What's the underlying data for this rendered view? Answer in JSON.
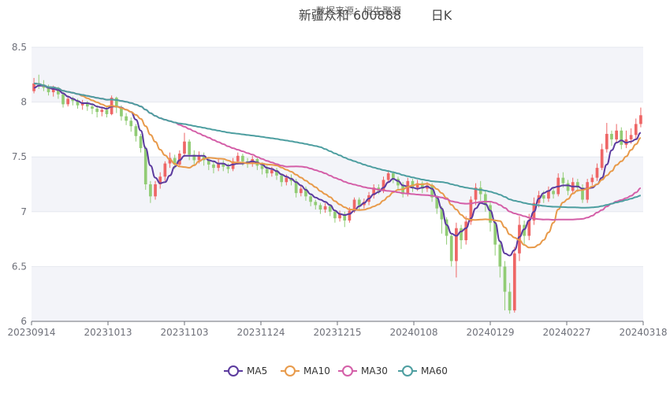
{
  "chart_data": {
    "type": "candlestick",
    "title": "新疆众和 600888",
    "subtitle": "日K",
    "source": "数据来源：恒生聚源",
    "ylim": [
      6,
      8.5
    ],
    "yticks": [
      "6",
      "6.5",
      "7",
      "7.5",
      "8",
      "8.5"
    ],
    "xticks": [
      "20230914",
      "20231013",
      "20231103",
      "20231124",
      "20231215",
      "20240108",
      "20240129",
      "20240227",
      "20240318"
    ],
    "up_color": "#ee6666",
    "down_color": "#91cc75",
    "band_colors": [
      "#f3f4f9",
      "#ffffff"
    ],
    "grid": true,
    "legend_position": "bottom-center",
    "series": [
      {
        "name": "MA5",
        "color": "#5b3a9e"
      },
      {
        "name": "MA10",
        "color": "#e89a4a"
      },
      {
        "name": "MA30",
        "color": "#d45fa8"
      },
      {
        "name": "MA60",
        "color": "#4d9ea0"
      }
    ],
    "candles": [
      [
        8.1,
        8.17,
        8.22,
        8.08
      ],
      [
        8.17,
        8.16,
        8.25,
        8.12
      ],
      [
        8.16,
        8.13,
        8.2,
        8.1
      ],
      [
        8.13,
        8.09,
        8.16,
        8.06
      ],
      [
        8.09,
        8.12,
        8.15,
        8.05
      ],
      [
        8.12,
        8.07,
        8.14,
        8.03
      ],
      [
        8.07,
        7.98,
        8.09,
        7.95
      ],
      [
        7.98,
        8.03,
        8.06,
        7.96
      ],
      [
        8.03,
        8.01,
        8.05,
        7.97
      ],
      [
        8.01,
        7.97,
        8.03,
        7.94
      ],
      [
        7.97,
        7.99,
        8.02,
        7.93
      ],
      [
        7.99,
        7.96,
        8.01,
        7.92
      ],
      [
        7.96,
        7.94,
        7.99,
        7.89
      ],
      [
        7.94,
        7.91,
        7.97,
        7.86
      ],
      [
        7.91,
        7.93,
        7.96,
        7.87
      ],
      [
        7.93,
        7.89,
        7.96,
        7.86
      ],
      [
        7.89,
        8.04,
        8.06,
        7.88
      ],
      [
        8.04,
        7.95,
        8.05,
        7.9
      ],
      [
        7.95,
        7.87,
        7.97,
        7.83
      ],
      [
        7.87,
        7.83,
        7.9,
        7.79
      ],
      [
        7.83,
        7.78,
        7.86,
        7.73
      ],
      [
        7.78,
        7.69,
        7.8,
        7.64
      ],
      [
        7.69,
        7.58,
        7.71,
        7.54
      ],
      [
        7.58,
        7.25,
        7.6,
        7.2
      ],
      [
        7.25,
        7.14,
        7.28,
        7.08
      ],
      [
        7.14,
        7.25,
        7.28,
        7.11
      ],
      [
        7.25,
        7.32,
        7.36,
        7.21
      ],
      [
        7.32,
        7.44,
        7.46,
        7.28
      ],
      [
        7.44,
        7.49,
        7.54,
        7.4
      ],
      [
        7.49,
        7.43,
        7.52,
        7.39
      ],
      [
        7.43,
        7.53,
        7.56,
        7.41
      ],
      [
        7.53,
        7.64,
        7.72,
        7.5
      ],
      [
        7.64,
        7.52,
        7.66,
        7.47
      ],
      [
        7.52,
        7.47,
        7.56,
        7.43
      ],
      [
        7.47,
        7.51,
        7.55,
        7.44
      ],
      [
        7.51,
        7.47,
        7.54,
        7.42
      ],
      [
        7.47,
        7.43,
        7.5,
        7.38
      ],
      [
        7.43,
        7.4,
        7.46,
        7.35
      ],
      [
        7.4,
        7.44,
        7.48,
        7.37
      ],
      [
        7.44,
        7.41,
        7.47,
        7.37
      ],
      [
        7.41,
        7.39,
        7.44,
        7.35
      ],
      [
        7.39,
        7.46,
        7.49,
        7.37
      ],
      [
        7.46,
        7.51,
        7.54,
        7.43
      ],
      [
        7.51,
        7.46,
        7.53,
        7.42
      ],
      [
        7.46,
        7.44,
        7.49,
        7.4
      ],
      [
        7.44,
        7.48,
        7.51,
        7.41
      ],
      [
        7.48,
        7.42,
        7.5,
        7.38
      ],
      [
        7.42,
        7.39,
        7.45,
        7.34
      ],
      [
        7.39,
        7.35,
        7.42,
        7.31
      ],
      [
        7.35,
        7.38,
        7.41,
        7.32
      ],
      [
        7.38,
        7.33,
        7.4,
        7.29
      ],
      [
        7.33,
        7.27,
        7.35,
        7.23
      ],
      [
        7.27,
        7.31,
        7.34,
        7.24
      ],
      [
        7.31,
        7.28,
        7.34,
        7.24
      ],
      [
        7.28,
        7.17,
        7.3,
        7.13
      ],
      [
        7.17,
        7.21,
        7.24,
        7.14
      ],
      [
        7.21,
        7.14,
        7.23,
        7.1
      ],
      [
        7.14,
        7.09,
        7.16,
        7.05
      ],
      [
        7.09,
        7.06,
        7.11,
        7.02
      ],
      [
        7.06,
        7.02,
        7.08,
        6.98
      ],
      [
        7.02,
        7.05,
        7.08,
        6.99
      ],
      [
        7.05,
        7.0,
        7.07,
        6.96
      ],
      [
        7.0,
        6.94,
        7.02,
        6.9
      ],
      [
        6.94,
        6.98,
        7.01,
        6.91
      ],
      [
        6.98,
        6.92,
        7.0,
        6.86
      ],
      [
        6.92,
        7.01,
        7.04,
        6.9
      ],
      [
        7.01,
        7.11,
        7.13,
        6.99
      ],
      [
        7.11,
        7.06,
        7.13,
        7.02
      ],
      [
        7.06,
        7.09,
        7.12,
        7.03
      ],
      [
        7.09,
        7.15,
        7.18,
        7.06
      ],
      [
        7.15,
        7.22,
        7.25,
        7.12
      ],
      [
        7.22,
        7.19,
        7.25,
        7.16
      ],
      [
        7.19,
        7.29,
        7.32,
        7.17
      ],
      [
        7.29,
        7.35,
        7.38,
        7.26
      ],
      [
        7.35,
        7.3,
        7.37,
        7.26
      ],
      [
        7.3,
        7.24,
        7.32,
        7.2
      ],
      [
        7.24,
        7.16,
        7.27,
        7.13
      ],
      [
        7.16,
        7.28,
        7.31,
        7.14
      ],
      [
        7.28,
        7.22,
        7.3,
        7.18
      ],
      [
        7.22,
        7.26,
        7.29,
        7.19
      ],
      [
        7.26,
        7.21,
        7.28,
        7.17
      ],
      [
        7.21,
        7.24,
        7.27,
        7.18
      ],
      [
        7.24,
        7.13,
        7.26,
        7.09
      ],
      [
        7.13,
        7.03,
        7.15,
        6.98
      ],
      [
        7.03,
        6.93,
        7.05,
        6.8
      ],
      [
        6.93,
        6.78,
        6.95,
        6.7
      ],
      [
        6.78,
        6.55,
        6.8,
        6.5
      ],
      [
        6.55,
        6.85,
        6.9,
        6.4
      ],
      [
        6.85,
        6.74,
        6.88,
        6.66
      ],
      [
        6.74,
        6.91,
        6.96,
        6.7
      ],
      [
        6.91,
        7.11,
        7.14,
        6.88
      ],
      [
        7.11,
        7.22,
        7.26,
        7.06
      ],
      [
        7.22,
        7.16,
        7.28,
        7.1
      ],
      [
        7.16,
        7.06,
        7.19,
        7.0
      ],
      [
        7.06,
        6.9,
        7.09,
        6.82
      ],
      [
        6.9,
        6.7,
        6.93,
        6.6
      ],
      [
        6.7,
        6.5,
        6.74,
        6.4
      ],
      [
        6.5,
        6.27,
        6.55,
        6.1
      ],
      [
        6.27,
        6.1,
        6.35,
        6.07
      ],
      [
        6.1,
        6.62,
        6.68,
        6.08
      ],
      [
        6.62,
        6.88,
        6.96,
        6.55
      ],
      [
        6.88,
        6.78,
        6.92,
        6.7
      ],
      [
        6.78,
        6.92,
        6.98,
        6.74
      ],
      [
        6.92,
        7.08,
        7.13,
        6.88
      ],
      [
        7.08,
        7.15,
        7.19,
        7.04
      ],
      [
        7.15,
        7.12,
        7.19,
        7.08
      ],
      [
        7.12,
        7.19,
        7.23,
        7.09
      ],
      [
        7.19,
        7.16,
        7.22,
        7.12
      ],
      [
        7.16,
        7.31,
        7.35,
        7.14
      ],
      [
        7.31,
        7.26,
        7.36,
        7.22
      ],
      [
        7.26,
        7.19,
        7.29,
        7.15
      ],
      [
        7.19,
        7.27,
        7.31,
        7.16
      ],
      [
        7.27,
        7.22,
        7.3,
        7.18
      ],
      [
        7.22,
        7.11,
        7.25,
        7.08
      ],
      [
        7.11,
        7.27,
        7.3,
        7.08
      ],
      [
        7.27,
        7.31,
        7.34,
        7.24
      ],
      [
        7.31,
        7.4,
        7.44,
        7.28
      ],
      [
        7.4,
        7.57,
        7.62,
        7.38
      ],
      [
        7.57,
        7.71,
        7.81,
        7.54
      ],
      [
        7.71,
        7.66,
        7.74,
        7.6
      ],
      [
        7.66,
        7.74,
        7.8,
        7.63
      ],
      [
        7.74,
        7.61,
        7.77,
        7.57
      ],
      [
        7.61,
        7.66,
        7.74,
        7.58
      ],
      [
        7.66,
        7.7,
        7.76,
        7.62
      ],
      [
        7.7,
        7.8,
        7.85,
        7.66
      ],
      [
        7.8,
        7.88,
        7.95,
        7.77
      ]
    ],
    "ma_series": {
      "MA5": [
        8.13,
        8.15,
        8.15,
        8.13,
        8.12,
        8.11,
        8.08,
        8.05,
        8.03,
        8.01,
        7.99,
        7.99,
        7.98,
        7.96,
        7.95,
        7.94,
        7.96,
        7.96,
        7.95,
        7.93,
        7.91,
        7.84,
        7.74,
        7.58,
        7.42,
        7.31,
        7.26,
        7.27,
        7.33,
        7.41,
        7.47,
        7.51,
        7.51,
        7.51,
        7.51,
        7.51,
        7.47,
        7.46,
        7.44,
        7.44,
        7.42,
        7.43,
        7.44,
        7.44,
        7.45,
        7.46,
        7.45,
        7.43,
        7.4,
        7.39,
        7.37,
        7.34,
        7.32,
        7.3,
        7.27,
        7.24,
        7.2,
        7.16,
        7.13,
        7.11,
        7.09,
        7.06,
        7.01,
        6.98,
        6.97,
        6.98,
        7.01,
        7.05,
        7.08,
        7.12,
        7.16,
        7.18,
        7.22,
        7.27,
        7.3,
        7.28,
        7.24,
        7.23,
        7.22,
        7.21,
        7.22,
        7.23,
        7.21,
        7.13,
        7.03,
        6.88,
        6.8,
        6.78,
        6.82,
        6.85,
        6.94,
        7.03,
        7.08,
        7.07,
        7.01,
        6.9,
        6.73,
        6.62,
        6.6,
        6.65,
        6.77,
        6.84,
        6.92,
        7.0,
        7.12,
        7.17,
        7.19,
        7.22,
        7.23,
        7.24,
        7.24,
        7.23,
        7.23,
        7.21,
        7.21,
        7.22,
        7.25,
        7.31,
        7.43,
        7.56,
        7.63,
        7.65,
        7.63,
        7.64,
        7.66,
        7.72
      ]
    },
    "legend": [
      "MA5",
      "MA10",
      "MA30",
      "MA60"
    ]
  }
}
